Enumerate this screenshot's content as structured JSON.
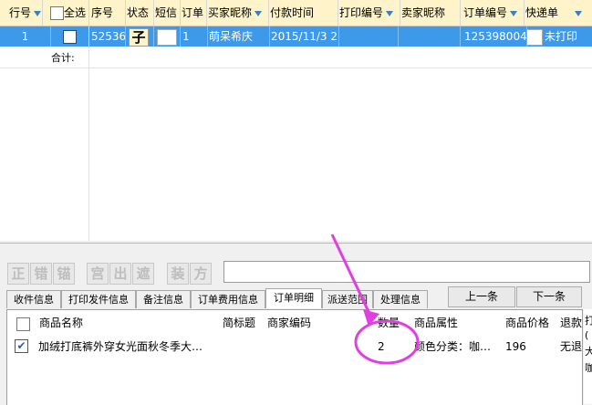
{
  "order_grid": {
    "columns": [
      "行号",
      "全选",
      "序号",
      "状态",
      "短信",
      "订单",
      "买家昵称",
      "付款时间",
      "打印编号",
      "卖家昵称",
      "订单编号",
      "快递单"
    ],
    "row": {
      "line_no": "1",
      "seq": "52536",
      "status": "子",
      "order_col": "1",
      "buyer": "萌呆希庆",
      "pay_time": "2015/11/3 2(",
      "print_no": "",
      "seller": "",
      "order_no": "125398004",
      "express": "未打印"
    },
    "total_label": "合计:"
  },
  "toolbar": {
    "buttons": [
      "正",
      "错",
      "锚",
      "宫",
      "出",
      "遮",
      "装",
      "方"
    ]
  },
  "tabs": [
    "收件信息",
    "打印发件信息",
    "备注信息",
    "订单费用信息",
    "订单明细",
    "派送范围",
    "处理信息"
  ],
  "active_tab": "订单明细",
  "pager": {
    "prev": "上一条",
    "next": "下一条"
  },
  "detail_grid": {
    "columns": [
      "商品名称",
      "简标题",
      "商家编码",
      "数量",
      "商品属性",
      "商品价格",
      "退款"
    ],
    "row": {
      "checked": true,
      "name": "加绒打底裤外穿女光面秋冬季大…",
      "short_title": "",
      "code": "",
      "qty": "2",
      "attr": "颜色分类：咖…",
      "price": "196",
      "refund": "无退"
    }
  },
  "side_panel": {
    "lines": [
      "打",
      "(",
      "大",
      "咖"
    ]
  },
  "annotation": {
    "color": "#e040e0"
  }
}
